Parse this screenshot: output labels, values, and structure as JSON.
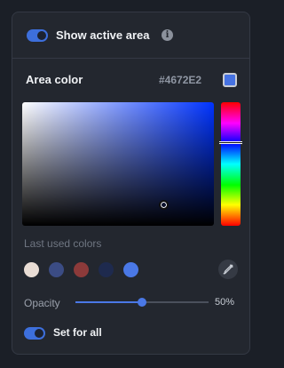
{
  "header": {
    "show_active_area_label": "Show active area",
    "show_active_area_on": true,
    "info_icon": "info-icon",
    "info_glyph": "i"
  },
  "area_color": {
    "label": "Area color",
    "hex": "#4672E2",
    "current_color": "#4672e2"
  },
  "picker": {
    "hue_color": "#0033ff",
    "hue_position": 0.33
  },
  "last_used": {
    "label": "Last used colors",
    "colors": [
      "#e9ddd5",
      "#3b4c84",
      "#8c3a3a",
      "#1e2a4e",
      "#4a78e6"
    ],
    "eyedropper_icon": "eyedropper-icon"
  },
  "opacity": {
    "label": "Opacity",
    "value_text": "50%",
    "value": 0.5
  },
  "set_for_all": {
    "label": "Set for all",
    "on": true
  },
  "colors": {
    "accent": "#4a78e6",
    "panel_bg": "#23272f",
    "page_bg": "#1b1f27"
  }
}
